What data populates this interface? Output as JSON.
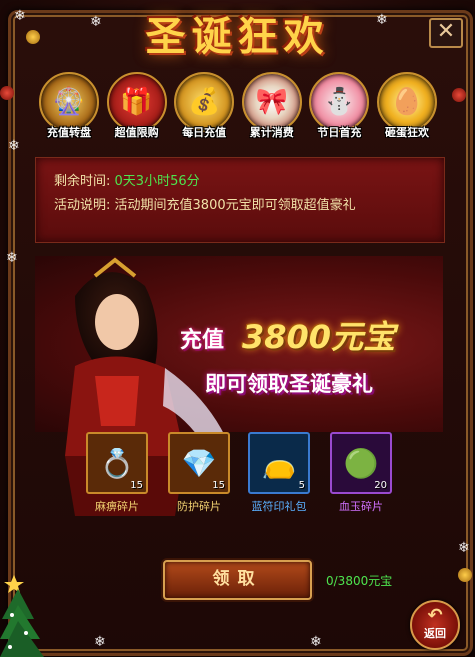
{
  "title": "圣诞狂欢",
  "close_label": "✕",
  "tabs": [
    {
      "label": "充值转盘",
      "icon": "roulette-icon"
    },
    {
      "label": "超值限购",
      "icon": "limited-gift-icon"
    },
    {
      "label": "每日充值",
      "icon": "gold-chest-icon"
    },
    {
      "label": "累计消费",
      "icon": "present-box-icon"
    },
    {
      "label": "节日首充",
      "icon": "snowman-icon"
    },
    {
      "label": "砸蛋狂欢",
      "icon": "golden-egg-icon"
    }
  ],
  "info": {
    "remaining_label": "剩余时间:",
    "remaining_value": "0天3小时56分",
    "desc_label": "活动说明:",
    "desc_value": "活动期间充值3800元宝即可领取超值豪礼"
  },
  "banner": {
    "prefix": "充值",
    "amount": "3800元宝",
    "subline": "即可领取圣诞豪礼"
  },
  "rewards": [
    {
      "name": "麻痹碎片",
      "count": "15",
      "icon": "ring-icon",
      "name_color": "#f0d070",
      "border": "#c98a2a",
      "bg": "#5a2a08"
    },
    {
      "name": "防护碎片",
      "count": "15",
      "icon": "gem-ring-icon",
      "name_color": "#f0d070",
      "border": "#c98a2a",
      "bg": "#5a2a08"
    },
    {
      "name": "蓝符印礼包",
      "count": "5",
      "icon": "green-bag-icon",
      "name_color": "#5ab0ff",
      "border": "#3a7ad0",
      "bg": "#0a2a4a"
    },
    {
      "name": "血玉碎片",
      "count": "20",
      "icon": "blood-jade-icon",
      "name_color": "#d070ff",
      "border": "#9a4ad0",
      "bg": "#2a0a3a"
    }
  ],
  "claim_label": "领取",
  "progress_text": "0/3800元宝",
  "back_label": "返回",
  "colors": {
    "accent_gold": "#ffd34a",
    "green_value": "#4ee44e",
    "panel_red": "#7a1414"
  }
}
